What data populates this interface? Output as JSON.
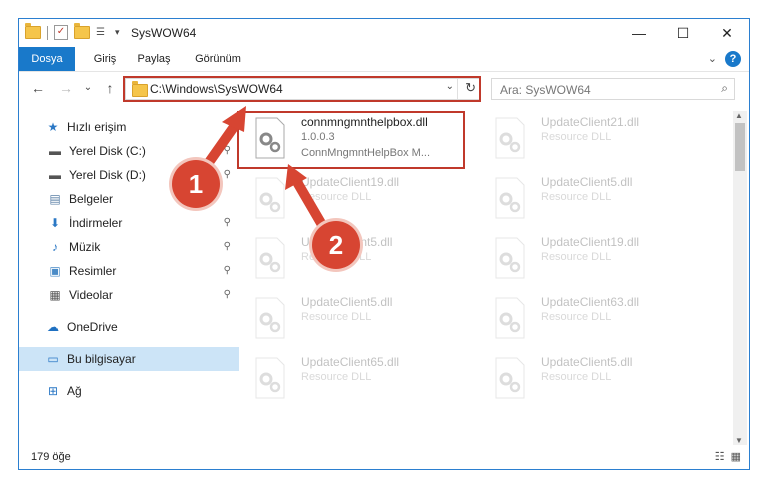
{
  "window": {
    "title": "SysWOW64",
    "minimize": "—",
    "maximize": "☐",
    "close": "✕"
  },
  "ribbon": {
    "tabs": [
      "Dosya",
      "Giriş",
      "Paylaş",
      "Görünüm"
    ],
    "help": "?"
  },
  "nav": {
    "back": "←",
    "forward": "→",
    "recent": "⌄",
    "up": "↑",
    "address": "C:\\Windows\\SysWOW64",
    "search_placeholder": "Ara: SysWOW64"
  },
  "sidebar": {
    "items": [
      {
        "label": "Hızlı erişim",
        "icon": "star-icon"
      },
      {
        "label": "Yerel Disk (C:)",
        "icon": "drive-icon"
      },
      {
        "label": "Yerel Disk (D:)",
        "icon": "drive-icon"
      },
      {
        "label": "Belgeler",
        "icon": "documents-icon"
      },
      {
        "label": "İndirmeler",
        "icon": "download-icon"
      },
      {
        "label": "Müzik",
        "icon": "music-icon"
      },
      {
        "label": "Resimler",
        "icon": "pictures-icon"
      },
      {
        "label": "Videolar",
        "icon": "videos-icon"
      },
      {
        "label": "OneDrive",
        "icon": "cloud-icon"
      },
      {
        "label": "Bu bilgisayar",
        "icon": "computer-icon"
      },
      {
        "label": "Ağ",
        "icon": "network-icon"
      }
    ]
  },
  "files": [
    {
      "name": "connmngmnthelpbox.dll",
      "meta": "1.0.0.3",
      "meta2": "ConnMngmntHelpBox M..."
    },
    {
      "name": "UpdateClient21.dll",
      "meta": "Resource DLL"
    },
    {
      "name": "UpdateClient19.dll",
      "meta": "Resource DLL"
    },
    {
      "name": "UpdateClient5.dll",
      "meta": "Resource DLL"
    },
    {
      "name": "UpdateClient5.dll",
      "meta": "Resource DLL"
    },
    {
      "name": "UpdateClient19.dll",
      "meta": "Resource DLL"
    },
    {
      "name": "UpdateClient5.dll",
      "meta": "Resource DLL"
    },
    {
      "name": "UpdateClient63.dll",
      "meta": "Resource DLL"
    },
    {
      "name": "UpdateClient65.dll",
      "meta": "Resource DLL"
    },
    {
      "name": "UpdateClient5.dll",
      "meta": "Resource DLL"
    }
  ],
  "status": {
    "count": "179 öğe"
  },
  "annotations": {
    "step1": "1",
    "step2": "2"
  },
  "colors": {
    "accent": "#1979ca",
    "highlight": "#c0392b",
    "badge": "#d74532"
  }
}
